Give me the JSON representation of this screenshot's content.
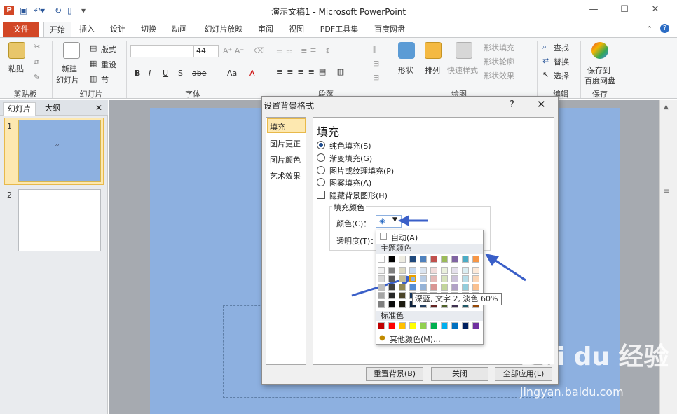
{
  "app": {
    "icon_letter": "P",
    "title": "演示文稿1 - Microsoft PowerPoint",
    "window_minimize": "—",
    "window_maximize": "☐",
    "window_close": "✕"
  },
  "tabs": {
    "file": "文件",
    "items": [
      "开始",
      "插入",
      "设计",
      "切换",
      "动画",
      "幻灯片放映",
      "审阅",
      "视图",
      "PDF工具集",
      "百度网盘"
    ]
  },
  "ribbon": {
    "clipboard": {
      "paste": "粘贴",
      "label": "剪贴板"
    },
    "slides": {
      "new_slide": "新建\n幻灯片",
      "new_slide_1": "新建",
      "new_slide_2": "幻灯片",
      "layout": "版式",
      "reset": "重设",
      "section": "节",
      "label": "幻灯片"
    },
    "font": {
      "size": "44",
      "label": "字体",
      "bold": "B",
      "italic": "I",
      "underline": "U",
      "strike": "S",
      "spacing": "abe",
      "aa": "Aa"
    },
    "paragraph": {
      "label": "段落"
    },
    "drawing": {
      "shapes": "形状",
      "arrange": "排列",
      "quick_styles": "快速样式",
      "shape_fill": "形状填充",
      "shape_outline": "形状轮廓",
      "shape_effects": "形状效果",
      "label": "绘图"
    },
    "editing": {
      "find": "查找",
      "replace": "替换",
      "select": "选择",
      "label": "编辑"
    },
    "save": {
      "save_to_1": "保存到",
      "save_to_2": "百度网盘",
      "label": "保存"
    }
  },
  "left_pane": {
    "tab_slides": "幻灯片",
    "tab_outline": "大纲",
    "close": "✕",
    "slides": [
      {
        "number": "1",
        "text": "PPT"
      },
      {
        "number": "2",
        "text": ""
      }
    ]
  },
  "dialog": {
    "title": "设置背景格式",
    "help": "?",
    "close": "✕",
    "nav": [
      "填充",
      "图片更正",
      "图片颜色",
      "艺术效果"
    ],
    "panel_heading": "填充",
    "options": [
      {
        "label": "纯色填充(S)",
        "selected": true
      },
      {
        "label": "渐变填充(G)",
        "selected": false
      },
      {
        "label": "图片或纹理填充(P)",
        "selected": false
      },
      {
        "label": "图案填充(A)",
        "selected": false
      }
    ],
    "hide_bg": "隐藏背景图形(H)",
    "fill_color_group": "填充颜色",
    "color_label": "颜色(C)：",
    "transparency_label": "透明度(T)：",
    "buttons": {
      "reset": "重置背景(B)",
      "close": "关闭",
      "apply_all": "全部应用(L)"
    }
  },
  "color_picker": {
    "auto": "自动(A)",
    "theme_colors": "主题颜色",
    "standard_colors": "标准色",
    "more_colors": "其他颜色(M)...",
    "theme_top": [
      "#ffffff",
      "#000000",
      "#eeece1",
      "#1f497d",
      "#4f81bd",
      "#c0504d",
      "#9bbb59",
      "#8064a2",
      "#4bacc6",
      "#f79646"
    ],
    "theme_shades": [
      [
        "#f2f2f2",
        "#7f7f7f",
        "#ddd9c3",
        "#c6d9f0",
        "#dbe5f1",
        "#f2dcdb",
        "#ebf1dd",
        "#e5e0ec",
        "#dbeef3",
        "#fdeada"
      ],
      [
        "#d8d8d8",
        "#595959",
        "#c4bd97",
        "#8db3e2",
        "#b8cce4",
        "#e5b9b7",
        "#d7e3bc",
        "#ccc1d9",
        "#b7dde8",
        "#fbd5b5"
      ],
      [
        "#bfbfbf",
        "#3f3f3f",
        "#938953",
        "#548dd4",
        "#95b3d7",
        "#d99694",
        "#c3d69b",
        "#b2a2c7",
        "#92cddc",
        "#fac08f"
      ],
      [
        "#a5a5a5",
        "#262626",
        "#494429",
        "#17365d",
        "#366092",
        "#953734",
        "#76923c",
        "#5f497a",
        "#31859b",
        "#e36c09"
      ],
      [
        "#7f7f7f",
        "#0c0c0c",
        "#1d1b10",
        "#0f243e",
        "#244061",
        "#632423",
        "#4f6128",
        "#3f3151",
        "#205867",
        "#974806"
      ]
    ],
    "standard": [
      "#c00000",
      "#ff0000",
      "#ffc000",
      "#ffff00",
      "#92d050",
      "#00b050",
      "#00b0f0",
      "#0070c0",
      "#002060",
      "#7030a0"
    ],
    "tooltip": "深蓝, 文字 2, 淡色 60%"
  },
  "watermark": {
    "logo": "Bai du 经验",
    "url": "jingyan.baidu.com"
  },
  "colors": {
    "accent": "#d24726",
    "slide_bg": "#8db0e0",
    "selection": "#fde8b0"
  }
}
